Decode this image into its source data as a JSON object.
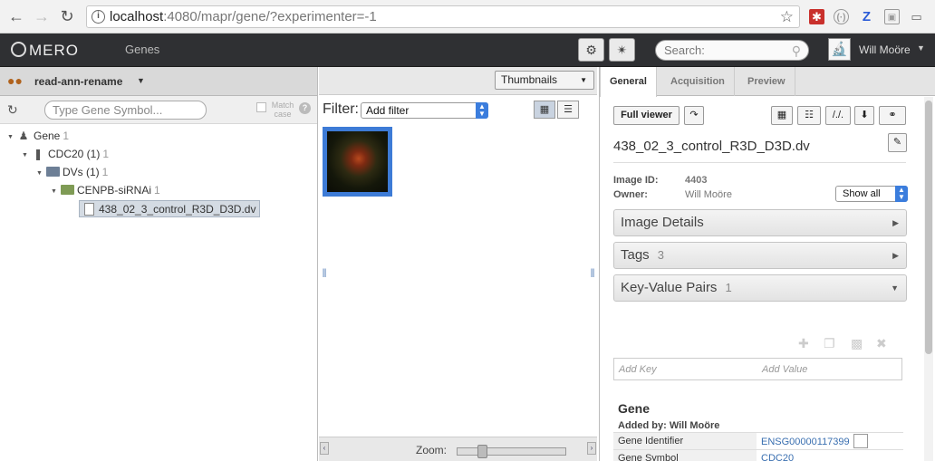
{
  "browser": {
    "url_host": "localhost",
    "url_rest": ":4080/mapr/gene/?experimenter=-1"
  },
  "topbar": {
    "logo": "OMERO",
    "nav_tab": "Genes",
    "search_placeholder": "Search:",
    "user_name": "Will Moöre"
  },
  "left": {
    "group_name": "read-ann-rename",
    "gene_search_placeholder": "Type Gene Symbol...",
    "match_case_label": "Match case",
    "tree": [
      {
        "label": "Gene",
        "count": "1"
      },
      {
        "label": "CDC20 (1)",
        "count": "1"
      },
      {
        "label": "DVs (1)",
        "count": "1"
      },
      {
        "label": "CENPB-siRNAi",
        "count": "1"
      },
      {
        "label": "438_02_3_control_R3D_D3D.dv",
        "count": ""
      }
    ]
  },
  "center": {
    "view_mode": "Thumbnails",
    "filter_label": "Filter:",
    "filter_value": "Add filter",
    "zoom_label": "Zoom:",
    "zoom_level": 0.2
  },
  "right": {
    "tabs": [
      "General",
      "Acquisition",
      "Preview"
    ],
    "full_viewer_label": "Full viewer",
    "image_title": "438_02_3_control_R3D_D3D.dv",
    "image_id_label": "Image ID:",
    "image_id": "4403",
    "owner_label": "Owner:",
    "owner": "Will Moöre",
    "show_all": "Show all",
    "sections": [
      {
        "label": "Image Details",
        "count": ""
      },
      {
        "label": "Tags",
        "count": "3"
      },
      {
        "label": "Key-Value Pairs",
        "count": "1"
      }
    ],
    "add_key": "Add Key",
    "add_value": "Add Value",
    "gene": {
      "title": "Gene",
      "added_by": "Added by: Will Moöre",
      "rows": [
        {
          "key": "Gene Identifier",
          "value": "ENSG00000117399"
        },
        {
          "key": "Gene Symbol",
          "value": "CDC20"
        }
      ]
    }
  }
}
